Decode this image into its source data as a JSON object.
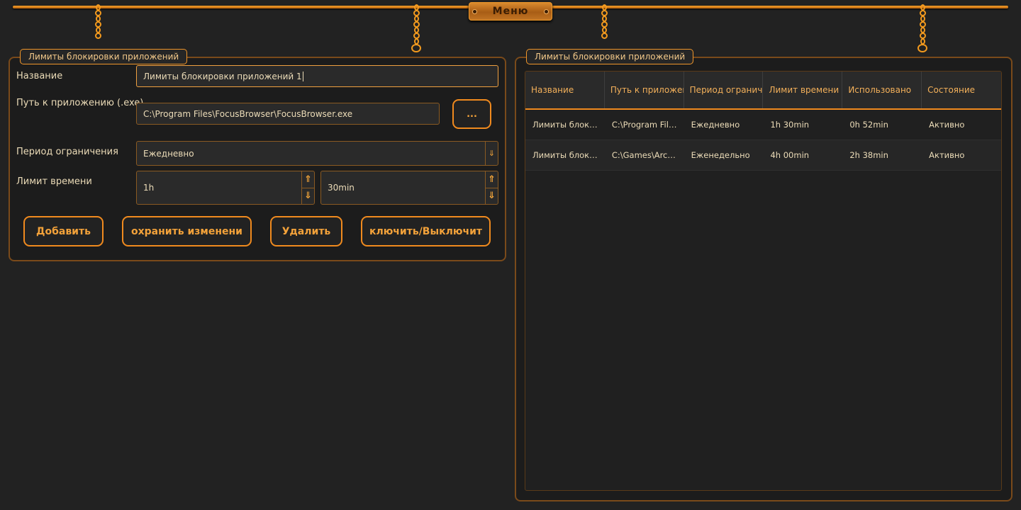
{
  "menu": {
    "label": "Меню"
  },
  "form_group": {
    "title": "Лимиты блокировки приложений",
    "name_label": "Название",
    "name_value": "Лимиты блокировки приложений 1",
    "path_label": "Путь к приложению (.exe)",
    "path_value": "C:\\Program Files\\FocusBrowser\\FocusBrowser.exe",
    "browse_label": "...",
    "period_label": "Период ограничения",
    "period_value": "Ежедневно",
    "limit_label": "Лимит времени",
    "hours_value": "1h",
    "minutes_value": "30min"
  },
  "buttons": {
    "add": "Добавить",
    "save": "охранить изменени",
    "delete": "Удалить",
    "toggle": "ключить/Выключит"
  },
  "list_group": {
    "title": "Лимиты блокировки приложений",
    "columns": [
      "Название",
      "Путь к приложен",
      "Период огранич",
      "Лимит времени",
      "Использовано",
      "Состояние"
    ],
    "rows": [
      [
        "Лимиты блоки...",
        "C:\\Program File...",
        "Ежедневно",
        "1h 30min",
        "0h 52min",
        "Активно"
      ],
      [
        "Лимиты блоки...",
        "C:\\Games\\Arca...",
        "Еженедельно",
        "4h 00min",
        "2h 38min",
        "Активно"
      ]
    ]
  },
  "icons": {
    "dropdown": "arrow-down-icon",
    "spin_up": "arrow-up-icon",
    "spin_down": "arrow-down-icon"
  },
  "colors": {
    "accent": "#f08a1e",
    "background": "#222222",
    "text": "#ecdcb8"
  }
}
